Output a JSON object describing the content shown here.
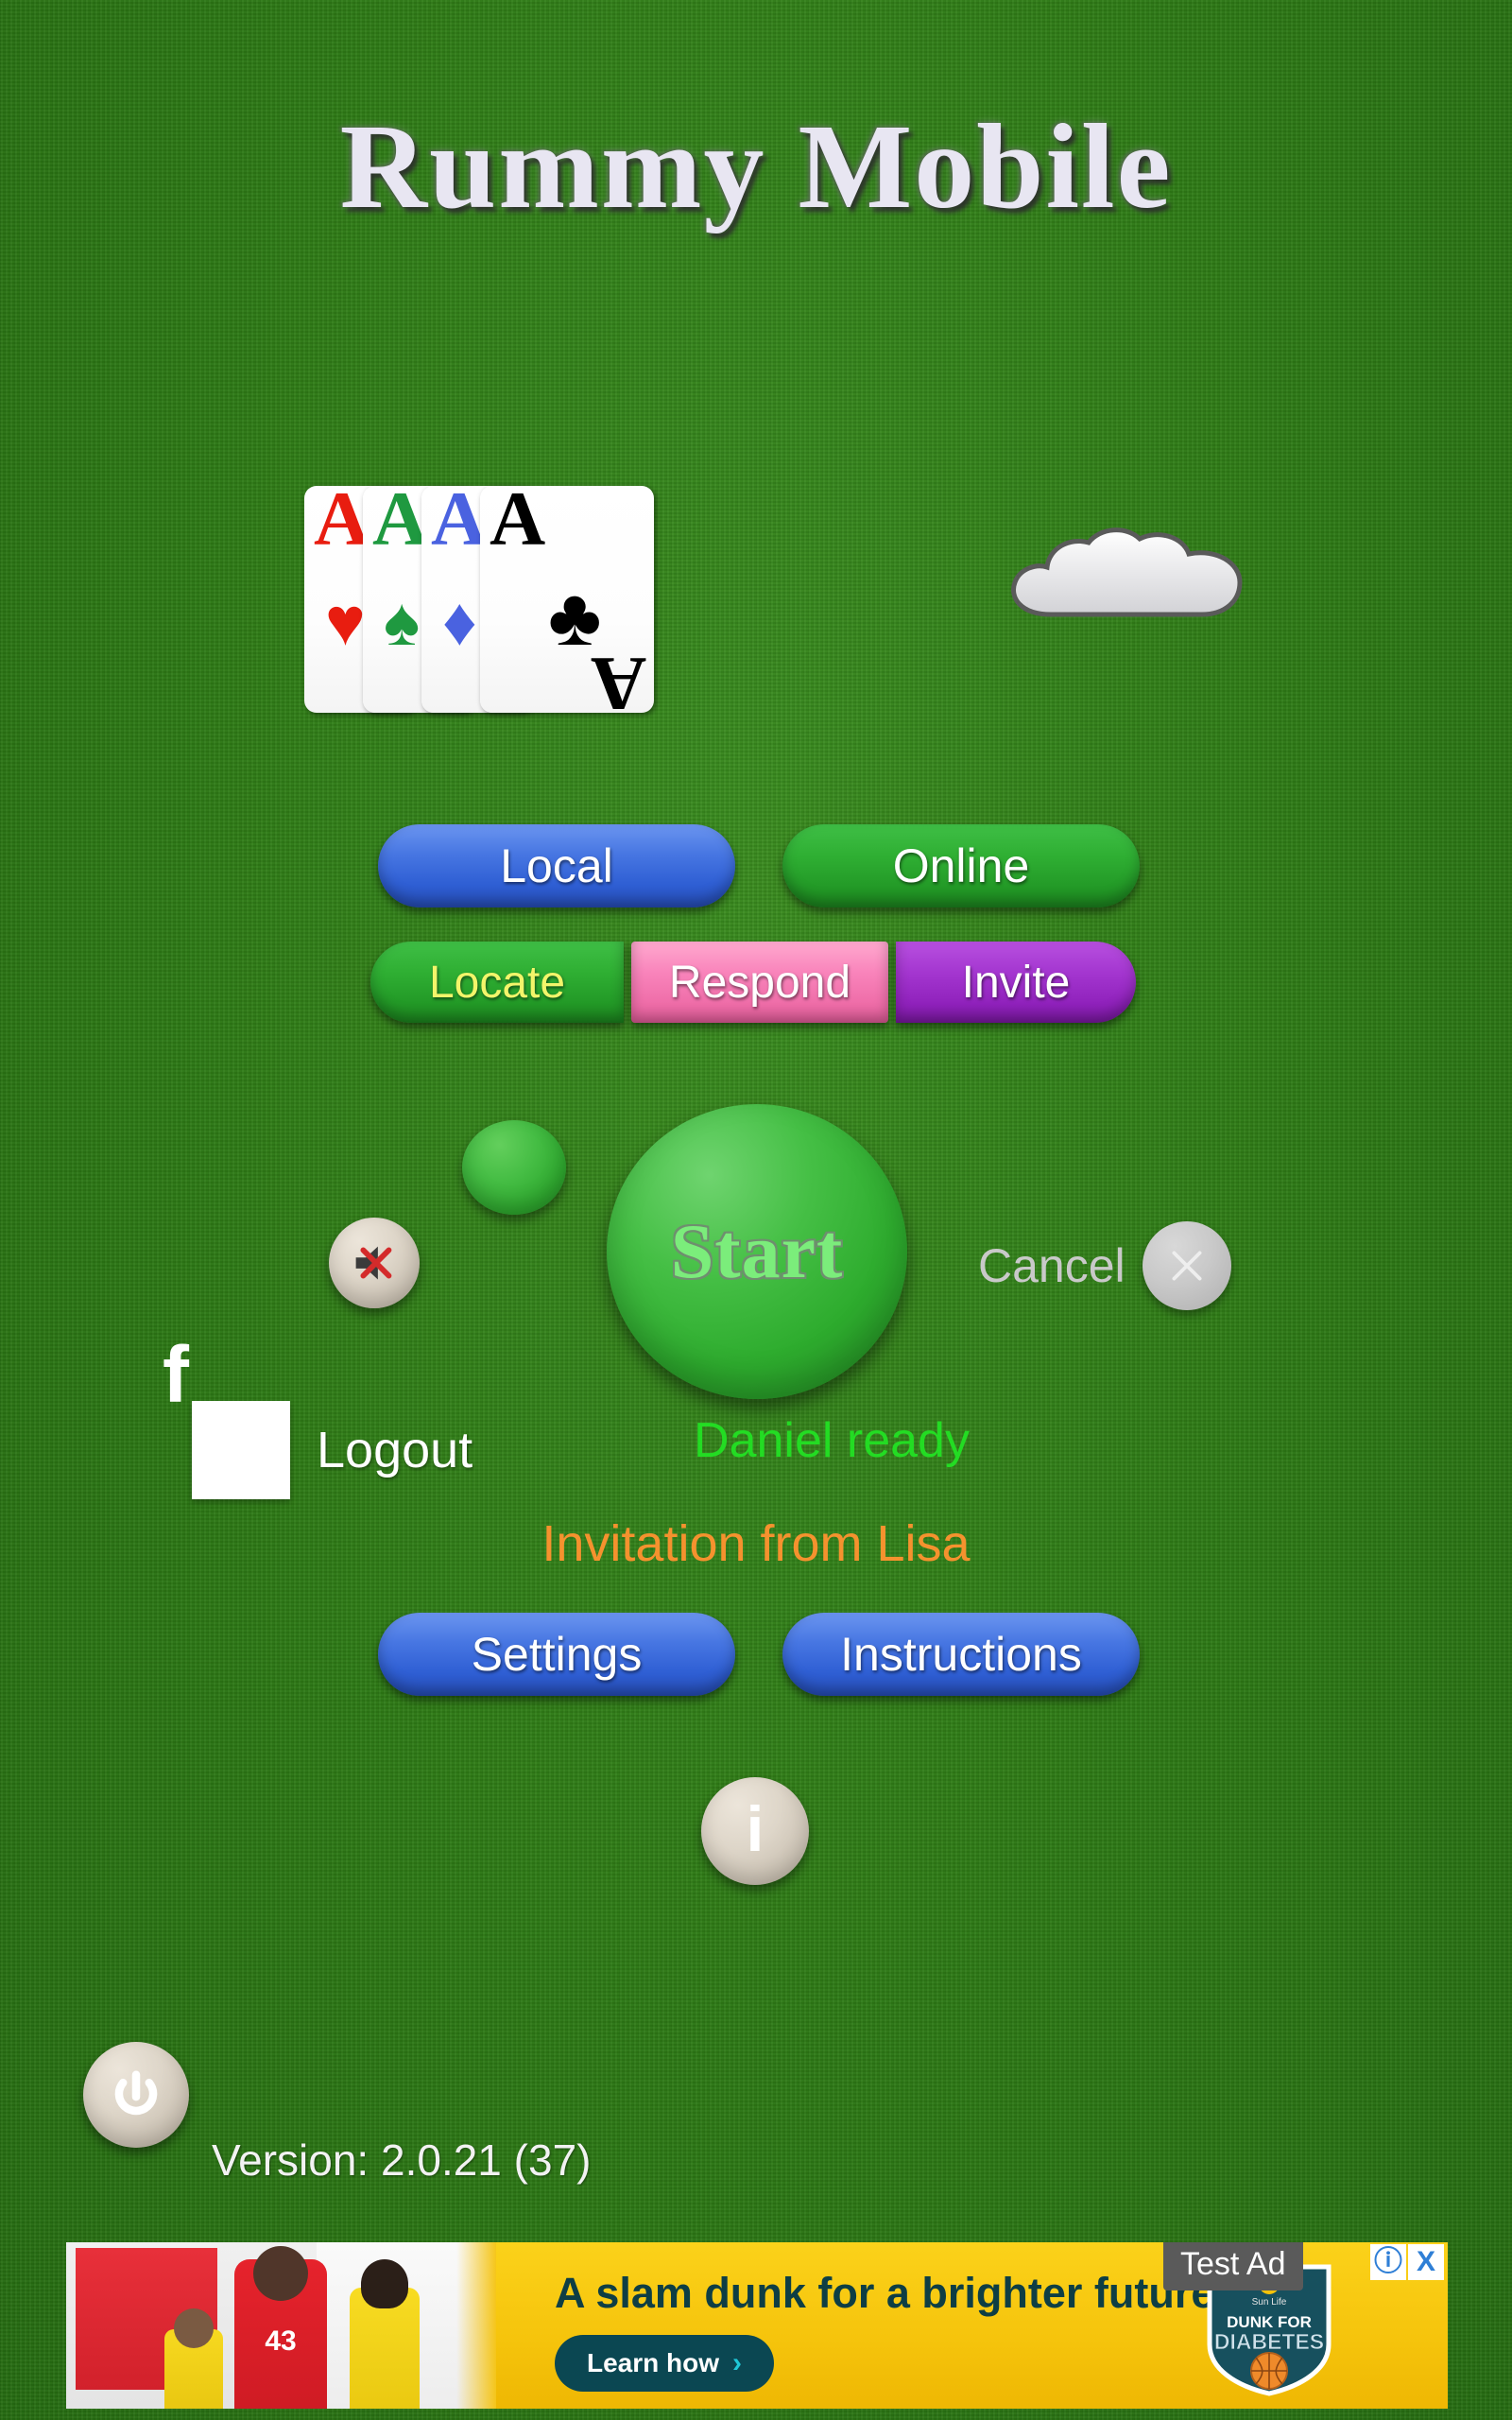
{
  "app": {
    "title": "Rummy Mobile",
    "version_label": "Version: 2.0.21 (37)"
  },
  "cards": [
    {
      "rank": "A",
      "suit": "heart",
      "glyph": "♥",
      "color": "#e81d10"
    },
    {
      "rank": "A",
      "suit": "spade",
      "glyph": "♠",
      "color": "#1f9940"
    },
    {
      "rank": "A",
      "suit": "diamond",
      "glyph": "♦",
      "color": "#4a62e0"
    },
    {
      "rank": "A",
      "suit": "club",
      "glyph": "♣",
      "color": "#000000"
    }
  ],
  "mode_buttons": {
    "local": "Local",
    "online": "Online"
  },
  "online_buttons": {
    "locate": "Locate",
    "respond": "Respond",
    "invite": "Invite"
  },
  "start": {
    "label": "Start"
  },
  "cancel": {
    "label": "Cancel"
  },
  "account": {
    "logout_label": "Logout"
  },
  "status": {
    "player": "Daniel ready",
    "invitation": "Invitation from Lisa"
  },
  "footer_buttons": {
    "settings": "Settings",
    "instructions": "Instructions"
  },
  "icons": {
    "mute": "mute-icon",
    "info": "i",
    "power": "power-icon",
    "facebook": "f",
    "cancel_x": "close-icon",
    "cloud": "cloud-icon",
    "status_dot": "status-dot-icon"
  },
  "ad": {
    "badge": "Test Ad",
    "headline": "A slam dunk for a brighter future.",
    "cta_label": "Learn how",
    "cta_chevron": "›",
    "logo_brand": "Sun Life",
    "logo_line1": "DUNK FOR",
    "logo_line2": "DIABETES",
    "jersey_number": "43",
    "info_icon": "ⓘ",
    "close_icon": "X"
  },
  "colors": {
    "background_green": "#2d7a15",
    "blue_button": "#4776e2",
    "green_button": "#2faf33",
    "pink_button": "#f984bb",
    "purple_button": "#a335cf",
    "locate_text_yellow": "#f3f56a",
    "ready_green": "#23dc23",
    "invitation_orange": "#f5922e",
    "ad_yellow": "#f5c20a",
    "ad_teal": "#0b4752"
  }
}
